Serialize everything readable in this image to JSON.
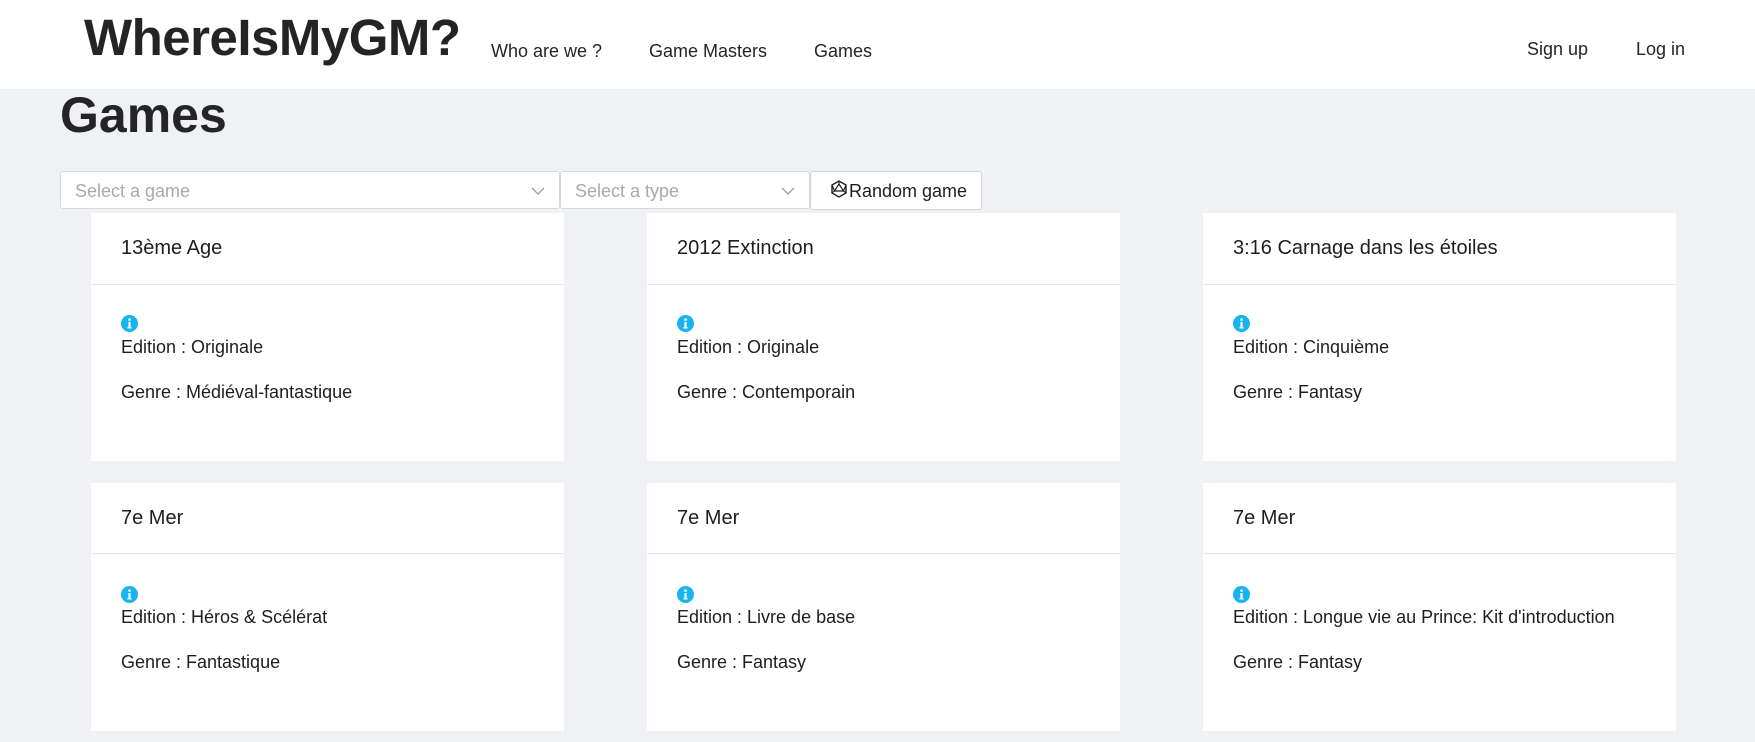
{
  "header": {
    "brand": "WhereIsMyGM?",
    "nav": [
      "Who are we ?",
      "Game Masters",
      "Games"
    ],
    "auth": [
      "Sign up",
      "Log in"
    ]
  },
  "page": {
    "title": "Games"
  },
  "filters": {
    "game_placeholder": "Select a game",
    "type_placeholder": "Select a type",
    "random_label": "Random game"
  },
  "colors": {
    "info_icon": "#18b4f0",
    "background": "#f0f1f5"
  },
  "cards": [
    {
      "title": "13ème Age",
      "edition": "Edition : Originale",
      "genre": "Genre : Médiéval-fantastique"
    },
    {
      "title": "2012 Extinction",
      "edition": "Edition : Originale",
      "genre": "Genre : Contemporain"
    },
    {
      "title": "3:16 Carnage dans les étoiles",
      "edition": "Edition : Cinquième",
      "genre": "Genre : Fantasy"
    },
    {
      "title": "7e Mer",
      "edition": "Edition : Héros & Scélérat",
      "genre": "Genre : Fantastique"
    },
    {
      "title": "7e Mer",
      "edition": "Edition : Livre de base",
      "genre": "Genre : Fantasy"
    },
    {
      "title": "7e Mer",
      "edition": "Edition : Longue vie au Prince: Kit d'introduction",
      "genre": "Genre : Fantasy"
    }
  ]
}
